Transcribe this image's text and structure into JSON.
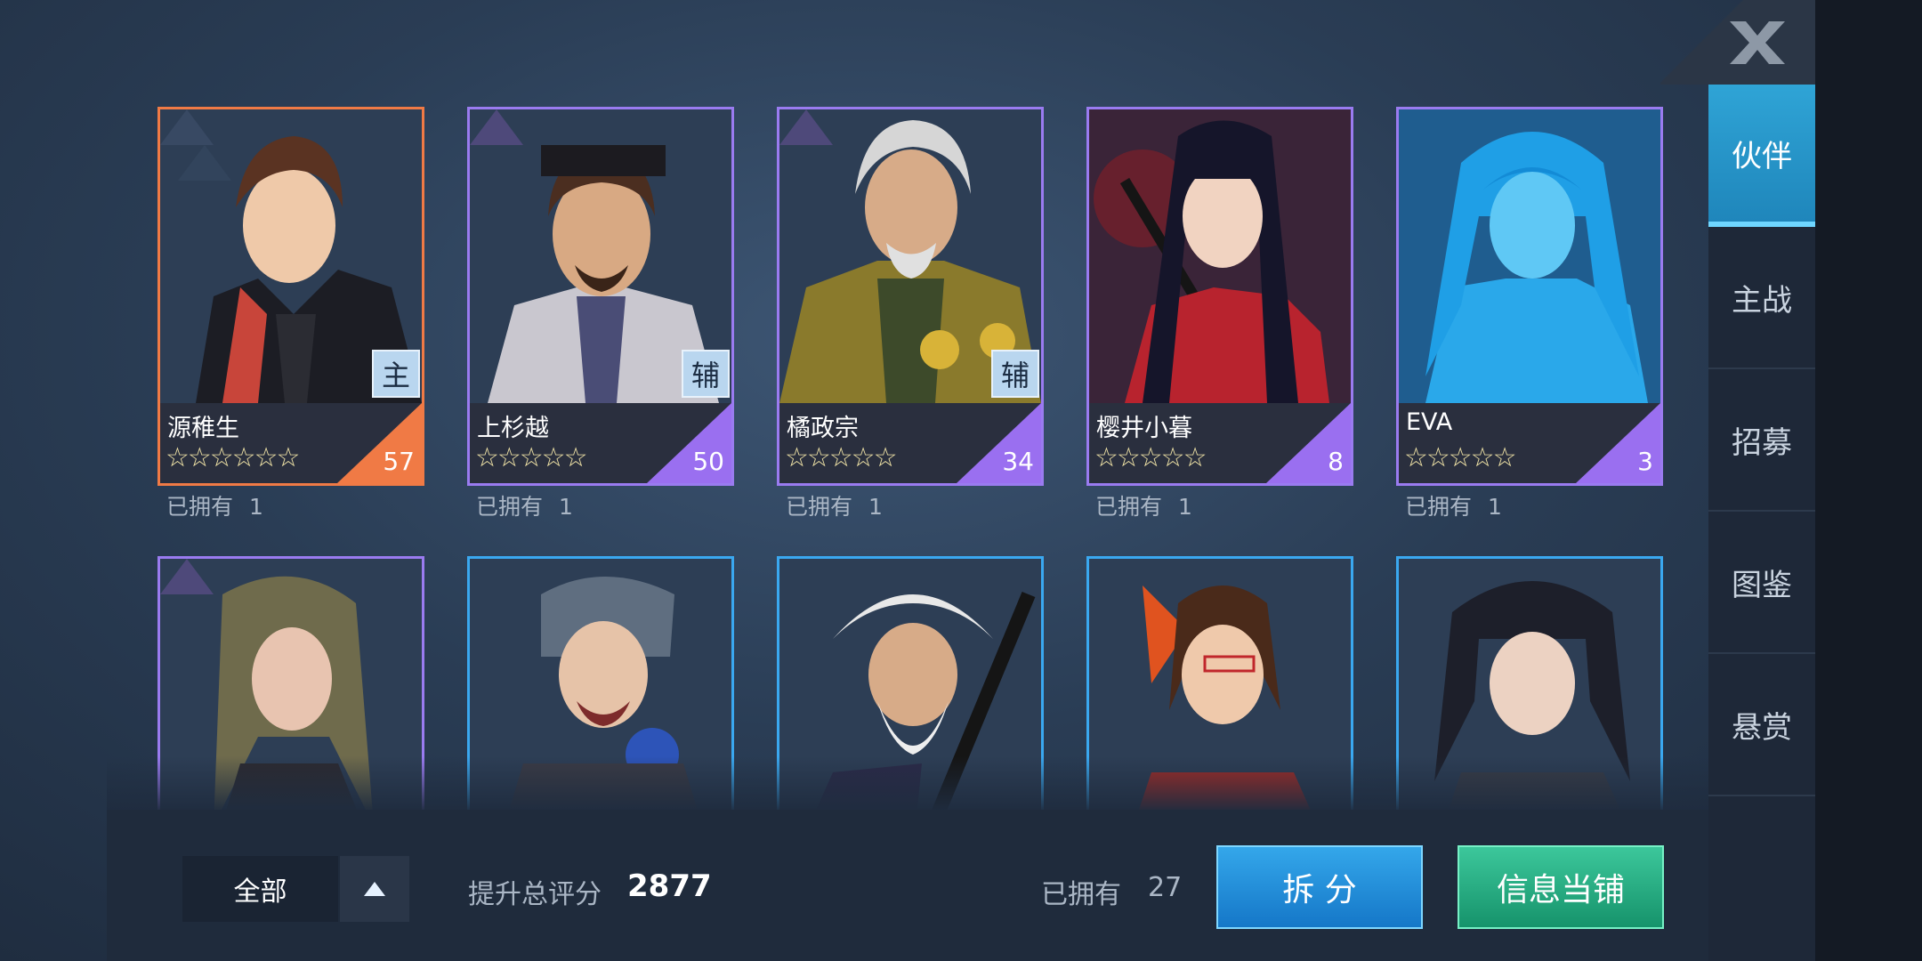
{
  "close": {
    "icon": "close-x-icon"
  },
  "tabs": [
    {
      "label": "伙伴",
      "active": true
    },
    {
      "label": "主战",
      "active": false
    },
    {
      "label": "招募",
      "active": false
    },
    {
      "label": "图鉴",
      "active": false
    },
    {
      "label": "悬赏",
      "active": false
    }
  ],
  "cards": [
    {
      "name": "源稚生",
      "stars": "☆☆☆☆☆☆",
      "level": "57",
      "role": "主",
      "owned_label": "已拥有",
      "owned_count": "1",
      "rarity_color": "#f07a45"
    },
    {
      "name": "上杉越",
      "stars": "☆☆☆☆☆",
      "level": "50",
      "role": "辅",
      "owned_label": "已拥有",
      "owned_count": "1",
      "rarity_color": "#9a7bf0"
    },
    {
      "name": "橘政宗",
      "stars": "☆☆☆☆☆",
      "level": "34",
      "role": "辅",
      "owned_label": "已拥有",
      "owned_count": "1",
      "rarity_color": "#9a7bf0"
    },
    {
      "name": "樱井小暮",
      "stars": "☆☆☆☆☆",
      "level": "8",
      "owned_label": "已拥有",
      "owned_count": "1",
      "rarity_color": "#9a7bf0"
    },
    {
      "name": "EVA",
      "stars": "☆☆☆☆☆",
      "level": "3",
      "owned_label": "已拥有",
      "owned_count": "1",
      "rarity_color": "#9a7bf0"
    }
  ],
  "cards_row2_colors": [
    "#9a7bf0",
    "#3aa8f0",
    "#3aa8f0",
    "#3aa8f0",
    "#3aa8f0"
  ],
  "bottom": {
    "filter_label": "全部",
    "filter_icon": "triangle-up-icon",
    "score_label": "提升总评分",
    "score_value": "2877",
    "owned_label": "已拥有",
    "owned_value": "27",
    "split_button": "拆 分",
    "pawn_button": "信息当铺"
  }
}
